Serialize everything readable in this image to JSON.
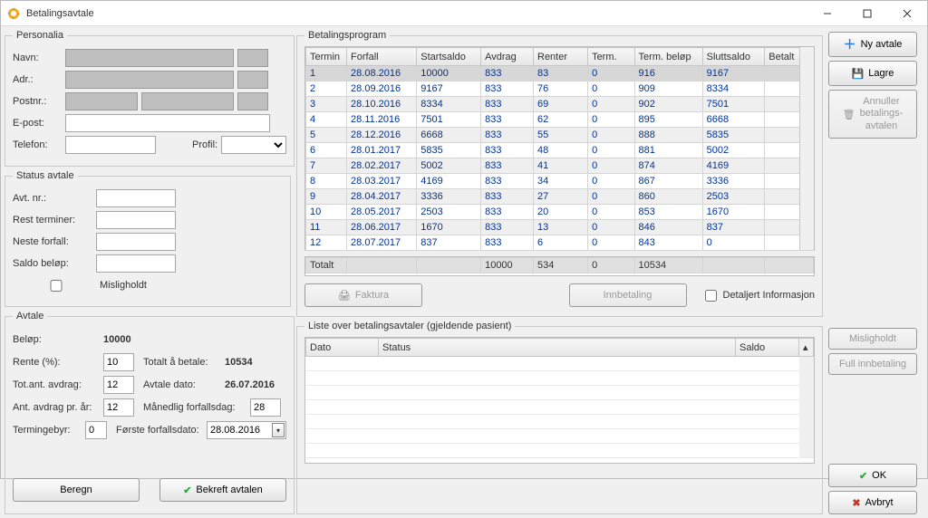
{
  "window": {
    "title": "Betalingsavtale"
  },
  "personalia": {
    "legend": "Personalia",
    "labels": {
      "navn": "Navn:",
      "adr": "Adr.:",
      "postnr": "Postnr.:",
      "epost": "E-post:",
      "telefon": "Telefon:",
      "profil": "Profil:"
    },
    "values": {
      "navn": "",
      "adr": "",
      "postnr1": "",
      "postnr2": "",
      "epost": "",
      "telefon": "",
      "profil": ""
    }
  },
  "status": {
    "legend": "Status avtale",
    "labels": {
      "avtnr": "Avt. nr.:",
      "rest": "Rest terminer:",
      "neste": "Neste forfall:",
      "saldo": "Saldo beløp:",
      "mis": "Misligholdt"
    },
    "values": {
      "avtnr": "",
      "rest": "",
      "neste": "",
      "saldo": ""
    }
  },
  "avtale": {
    "legend": "Avtale",
    "labels": {
      "belop": "Beløp:",
      "rente": "Rente (%):",
      "totaltbetale": "Totalt å betale:",
      "totant": "Tot.ant. avdrag:",
      "avtaledato": "Avtale dato:",
      "antprar": "Ant. avdrag pr. år:",
      "maned": "Månedlig forfallsdag:",
      "termingebyr": "Termingebyr:",
      "forste": "Første forfallsdato:",
      "beregn": "Beregn",
      "bekreft": "Bekreft avtalen"
    },
    "values": {
      "belop": "10000",
      "rente": "10",
      "totaltbetale": "10534",
      "totant": "12",
      "avtaledato": "26.07.2016",
      "antprar": "12",
      "maned": "28",
      "termingebyr": "0",
      "forste": "28.08.2016"
    }
  },
  "program": {
    "legend": "Betalingsprogram",
    "headers": [
      "Termin",
      "Forfall",
      "Startsaldo",
      "Avdrag",
      "Renter",
      "Term.",
      "Term. beløp",
      "Sluttsaldo",
      "Betalt"
    ],
    "rows": [
      [
        "1",
        "28.08.2016",
        "10000",
        "833",
        "83",
        "0",
        "916",
        "9167",
        ""
      ],
      [
        "2",
        "28.09.2016",
        "9167",
        "833",
        "76",
        "0",
        "909",
        "8334",
        ""
      ],
      [
        "3",
        "28.10.2016",
        "8334",
        "833",
        "69",
        "0",
        "902",
        "7501",
        ""
      ],
      [
        "4",
        "28.11.2016",
        "7501",
        "833",
        "62",
        "0",
        "895",
        "6668",
        ""
      ],
      [
        "5",
        "28.12.2016",
        "6668",
        "833",
        "55",
        "0",
        "888",
        "5835",
        ""
      ],
      [
        "6",
        "28.01.2017",
        "5835",
        "833",
        "48",
        "0",
        "881",
        "5002",
        ""
      ],
      [
        "7",
        "28.02.2017",
        "5002",
        "833",
        "41",
        "0",
        "874",
        "4169",
        ""
      ],
      [
        "8",
        "28.03.2017",
        "4169",
        "833",
        "34",
        "0",
        "867",
        "3336",
        ""
      ],
      [
        "9",
        "28.04.2017",
        "3336",
        "833",
        "27",
        "0",
        "860",
        "2503",
        ""
      ],
      [
        "10",
        "28.05.2017",
        "2503",
        "833",
        "20",
        "0",
        "853",
        "1670",
        ""
      ],
      [
        "11",
        "28.06.2017",
        "1670",
        "833",
        "13",
        "0",
        "846",
        "837",
        ""
      ],
      [
        "12",
        "28.07.2017",
        "837",
        "833",
        "6",
        "0",
        "843",
        "0",
        ""
      ]
    ],
    "total": {
      "label": "Totalt",
      "avdrag": "10000",
      "renter": "534",
      "term": "0",
      "termbelop": "10534"
    }
  },
  "toolbar": {
    "faktura": "Faktura",
    "innbetaling": "Innbetaling",
    "detaljert": "Detaljert Informasjon"
  },
  "list2": {
    "legend": "Liste over betalingsavtaler (gjeldende pasient)",
    "headers": [
      "Dato",
      "Status",
      "Saldo"
    ]
  },
  "rightbar": {
    "nyavtale": "Ny avtale",
    "lagre": "Lagre",
    "annuller1": "Annuller",
    "annuller2": "betalings-",
    "annuller3": "avtalen",
    "misligholdt": "Misligholdt",
    "fullinn": "Full innbetaling",
    "ok": "OK",
    "avbryt": "Avbryt"
  }
}
